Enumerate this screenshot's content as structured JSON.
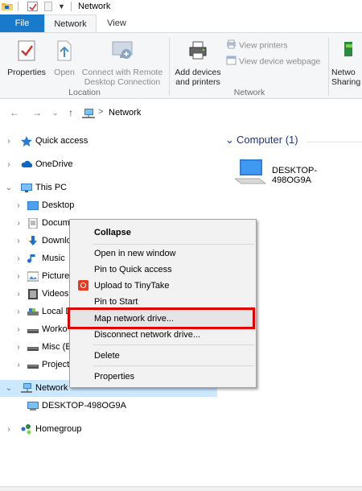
{
  "window": {
    "title": "Network"
  },
  "quick_access_toolbar": {
    "icons": [
      "folder-icon",
      "properties-check-icon",
      "new-folder-icon",
      "customize-dropdown-icon"
    ]
  },
  "ribbon": {
    "tabs": [
      {
        "label": "File",
        "active": false
      },
      {
        "label": "Network",
        "active": true
      },
      {
        "label": "View",
        "active": false
      }
    ],
    "location_group": {
      "label": "Location",
      "buttons": [
        {
          "label": "Properties",
          "icon": "properties-check-icon",
          "enabled": true
        },
        {
          "label": "Open",
          "icon": "open-arrow-icon",
          "enabled": false
        },
        {
          "label_line1": "Connect with Remote",
          "label_line2": "Desktop Connection",
          "icon": "remote-desktop-icon",
          "enabled": false
        }
      ]
    },
    "network_group": {
      "label": "Network",
      "add_devices": {
        "label_line1": "Add devices",
        "label_line2": "and printers",
        "icon": "printer-icon"
      },
      "view_printers": {
        "label": "View printers",
        "icon": "printer-small-icon",
        "enabled": false
      },
      "view_device_webpage": {
        "label": "View device webpage",
        "icon": "device-webpage-icon",
        "enabled": false
      }
    },
    "cut_off_button": {
      "label_line1": "Netwo",
      "label_line2": "Sharing"
    }
  },
  "address_bar": {
    "path": [
      "Network"
    ],
    "separator": ">"
  },
  "nav_tree": [
    {
      "label": "Quick access",
      "icon": "star-icon",
      "expanded": false
    },
    {
      "label": "OneDrive",
      "icon": "cloud-icon",
      "expanded": false
    },
    {
      "label": "This PC",
      "icon": "monitor-icon",
      "expanded": true
    },
    {
      "label": "Desktop",
      "icon": "desktop-folder-icon",
      "expanded": false
    },
    {
      "label": "Docum",
      "icon": "documents-icon",
      "expanded": false
    },
    {
      "label": "Downlo",
      "icon": "downloads-icon",
      "expanded": false
    },
    {
      "label": "Music",
      "icon": "music-icon",
      "expanded": false
    },
    {
      "label": "Picture",
      "icon": "pictures-icon",
      "expanded": false
    },
    {
      "label": "Videos",
      "icon": "videos-icon",
      "expanded": false
    },
    {
      "label": "Local D",
      "icon": "drive-icon",
      "expanded": false
    },
    {
      "label": "Worko",
      "icon": "drive-icon",
      "expanded": false
    },
    {
      "label": "Misc (E",
      "icon": "drive-icon",
      "expanded": false
    },
    {
      "label": "Project",
      "icon": "drive-icon",
      "expanded": false
    },
    {
      "label": "Network",
      "icon": "network-icon",
      "expanded": true,
      "selected": true
    },
    {
      "label": "DESKTOP-498OG9A",
      "icon": "computer-icon",
      "expanded": false
    },
    {
      "label": "Homegroup",
      "icon": "homegroup-icon",
      "expanded": false
    }
  ],
  "content": {
    "group_header": "Computer (1)",
    "items": [
      {
        "label": "DESKTOP-498OG9A",
        "icon": "computer-icon"
      }
    ]
  },
  "context_menu": {
    "items": [
      {
        "label": "Collapse",
        "bold": true
      },
      {
        "label": "Open in new window"
      },
      {
        "label": "Pin to Quick access"
      },
      {
        "label": "Upload to TinyTake",
        "icon": "tinytake-icon"
      },
      {
        "label": "Pin to Start"
      },
      {
        "label": "Map network drive...",
        "highlighted": true
      },
      {
        "label": "Disconnect network drive..."
      },
      {
        "label": "Delete"
      },
      {
        "label": "Properties"
      }
    ]
  },
  "colors": {
    "file_tab": "#1979ca",
    "selection": "#cce8ff",
    "highlight_box": "#e00000",
    "group_header": "#1e3287"
  }
}
